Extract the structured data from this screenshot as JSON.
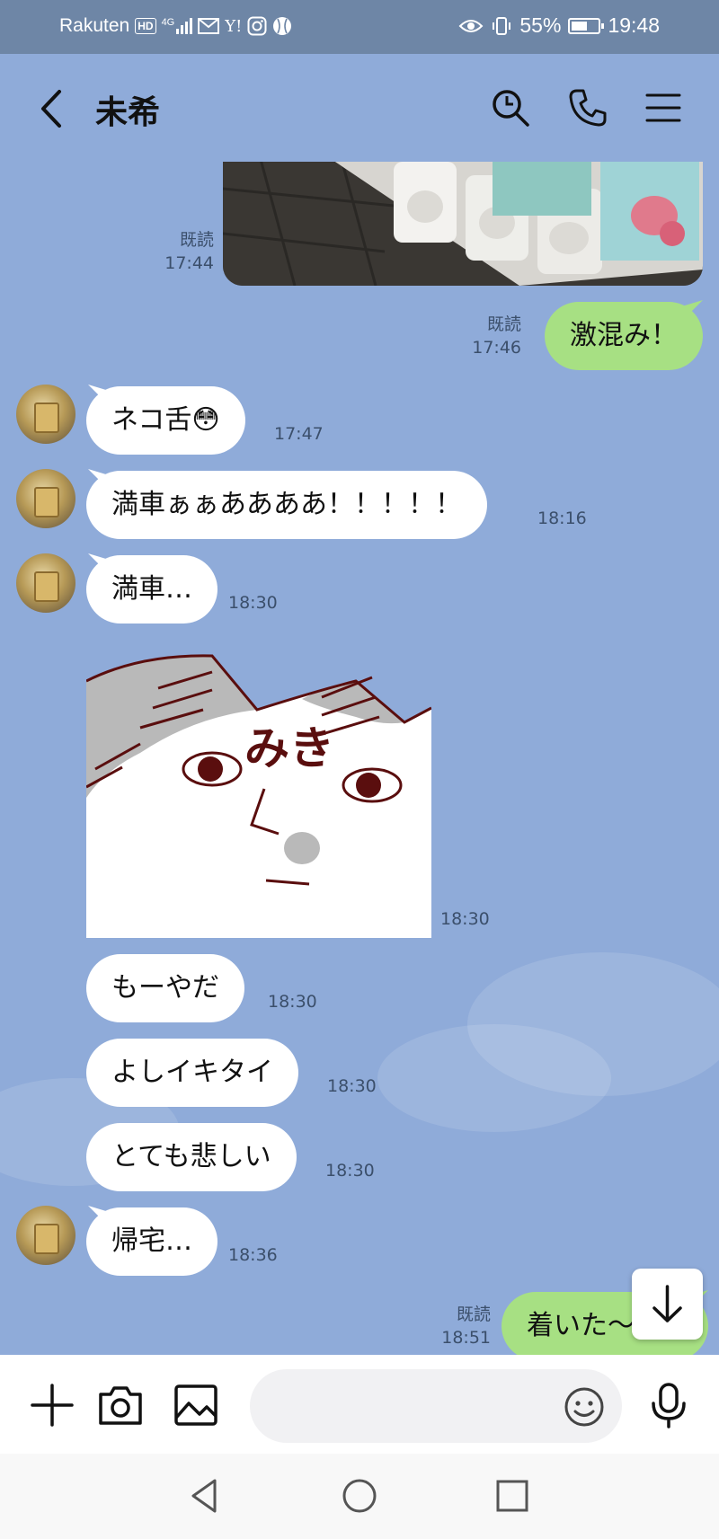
{
  "status_bar": {
    "carrier": "Rakuten",
    "hd_badge": "HD",
    "network": "4G",
    "battery": "55%",
    "time": "19:48"
  },
  "header": {
    "contact_name": "未希"
  },
  "chat": {
    "messages": [
      {
        "side": "mine",
        "type": "photo",
        "read_label": "既読",
        "time": "17:44"
      },
      {
        "side": "mine",
        "type": "text",
        "text": "激混み！",
        "read_label": "既読",
        "time": "17:46"
      },
      {
        "side": "theirs",
        "type": "text",
        "text": "ネコ舌😳",
        "time": "17:47"
      },
      {
        "side": "theirs",
        "type": "text",
        "text": "満車ぁぁああああ！！！！！",
        "time": "18:16"
      },
      {
        "side": "theirs",
        "type": "text",
        "text": "満車…",
        "time": "18:30"
      },
      {
        "side": "theirs",
        "type": "sticker",
        "sticker_text": "みき",
        "time": "18:30"
      },
      {
        "side": "theirs",
        "type": "text",
        "text": "もーやだ",
        "time": "18:30"
      },
      {
        "side": "theirs",
        "type": "text",
        "text": "よしイキタイ",
        "time": "18:30"
      },
      {
        "side": "theirs",
        "type": "text",
        "text": "とても悲しい",
        "time": "18:30"
      },
      {
        "side": "theirs",
        "type": "text",
        "text": "帰宅…",
        "time": "18:36"
      },
      {
        "side": "mine",
        "type": "text",
        "text": "着いた〜",
        "read_label": "既読",
        "time": "18:51"
      }
    ]
  },
  "input_bar": {
    "message_value": "",
    "message_placeholder": ""
  },
  "colors": {
    "chat_background": "#8fabd9",
    "my_bubble": "#a7e083",
    "their_bubble": "#ffffff",
    "status_bar": "#6e86a6"
  }
}
